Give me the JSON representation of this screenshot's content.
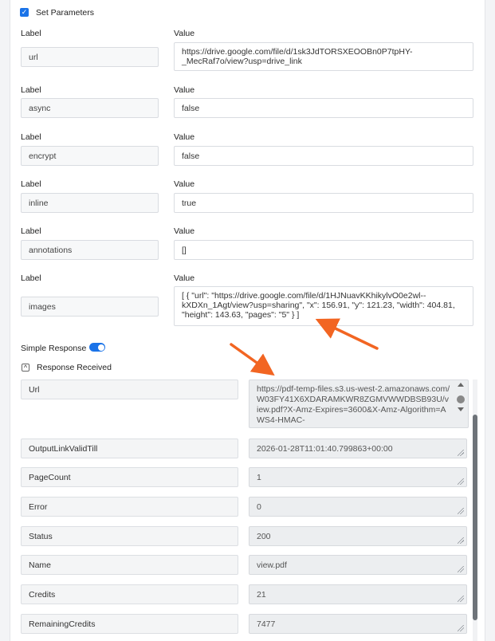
{
  "set_parameters": {
    "label": "Set Parameters",
    "checked": true
  },
  "columns": {
    "label": "Label",
    "value": "Value"
  },
  "params": [
    {
      "label": "url",
      "value": "https://drive.google.com/file/d/1sk3JdTORSXEOOBn0P7tpHY-_MecRaf7o/view?usp=drive_link"
    },
    {
      "label": "async",
      "value": "false"
    },
    {
      "label": "encrypt",
      "value": "false"
    },
    {
      "label": "inline",
      "value": "true"
    },
    {
      "label": "annotations",
      "value": "[]"
    },
    {
      "label": "images",
      "value": "[ { \"url\": \"https://drive.google.com/file/d/1HJNuavKKhikylvO0e2wl--kXDXn_1Agt/view?usp=sharing\", \"x\": 156.91, \"y\": 121.23, \"width\": 404.81, \"height\": 143.63, \"pages\": \"5\" } ]"
    }
  ],
  "simple_response": {
    "label": "Simple Response",
    "enabled": true
  },
  "response": {
    "title": "Response Received",
    "collapse_glyph": "^",
    "fields": [
      {
        "label": "Url",
        "value": "https://pdf-temp-files.s3.us-west-2.amazonaws.com/W03FY41X6XDARAMKWR8ZGMVWWDBSB93U/view.pdf?X-Amz-Expires=3600&X-Amz-Algorithm=AWS4-HMAC-"
      },
      {
        "label": "OutputLinkValidTill",
        "value": "2026-01-28T11:01:40.799863+00:00"
      },
      {
        "label": "PageCount",
        "value": "1"
      },
      {
        "label": "Error",
        "value": "0"
      },
      {
        "label": "Status",
        "value": "200"
      },
      {
        "label": "Name",
        "value": "view.pdf"
      },
      {
        "label": "Credits",
        "value": "21"
      },
      {
        "label": "RemainingCredits",
        "value": "7477"
      }
    ]
  },
  "colors": {
    "accent": "#1a73e8",
    "arrow": "#f26522"
  },
  "icons": {
    "check": "checkmark-icon",
    "arrow": "arrow-annotation-icon"
  }
}
